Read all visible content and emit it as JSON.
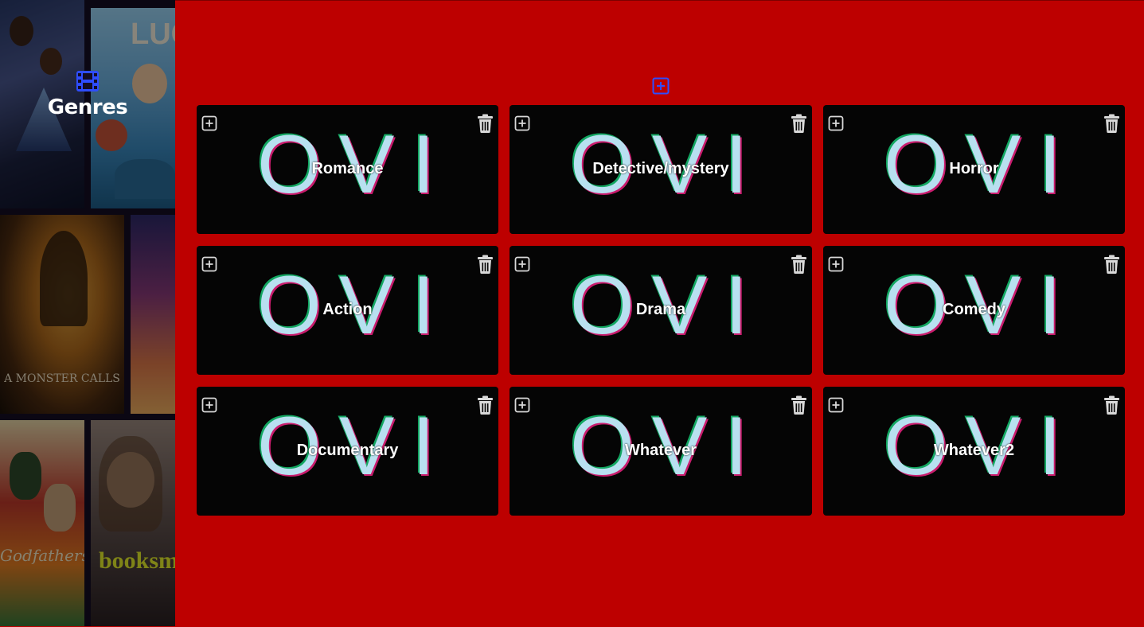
{
  "sidebar": {
    "title": "Genres",
    "brand_icon": "film-icon",
    "posters": [
      {
        "name": "black-panther-poster",
        "text": ""
      },
      {
        "name": "luca-poster",
        "text": "LUCA"
      },
      {
        "name": "a-monster-calls-poster",
        "text": "A MONSTER CALLS"
      },
      {
        "name": "sunset-poster",
        "text": ""
      },
      {
        "name": "godfathers-poster",
        "text": "Godfathers"
      },
      {
        "name": "booksmart-poster",
        "text": "booksm"
      }
    ]
  },
  "main": {
    "add_icon": "plus-square-icon",
    "genres": [
      {
        "label": "Romance",
        "image_text": "MOVIE"
      },
      {
        "label": "Detective/mystery",
        "image_text": "MOVIE"
      },
      {
        "label": "Horror",
        "image_text": "MOVIE"
      },
      {
        "label": "Action",
        "image_text": "MOVIE"
      },
      {
        "label": "Drama",
        "image_text": "MOVIE"
      },
      {
        "label": "Comedy",
        "image_text": "MOVIE"
      },
      {
        "label": "Documentary",
        "image_text": "MOVIE"
      },
      {
        "label": "Whatever",
        "image_text": "MOVIE"
      },
      {
        "label": "Whatever2",
        "image_text": "MOVIE"
      }
    ]
  },
  "colors": {
    "background": "#bd0000",
    "accent": "#2e4dff",
    "card": "#050505",
    "icon": "#d9d9d9"
  }
}
